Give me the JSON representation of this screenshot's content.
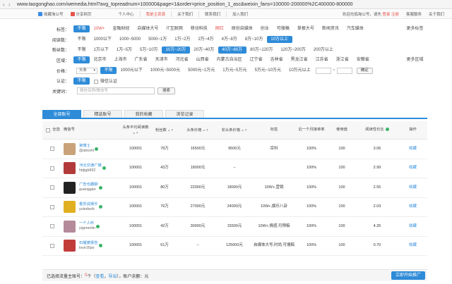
{
  "browser": {
    "url": "www.taogonghao.com/wemedia.html?avg_topreadnum=100000&page=1&order=price_position_1_asc&weixin_fans=100000-200000%2C400000-800000"
  },
  "topbar": {
    "left": [
      "收藏淘公号",
      "分享网页"
    ],
    "nav": [
      {
        "label": "个人中心",
        "hl": false
      },
      {
        "label": "我是主资源",
        "hl": true
      },
      {
        "label": "关于我们",
        "hl": false
      },
      {
        "label": "联系我们",
        "hl": false
      },
      {
        "label": "加入我们",
        "hl": false
      }
    ],
    "welcome": "欢迎光临淘公号，请先",
    "login": "登录",
    "register": "注册",
    "service": "客服服务",
    "about": "关于我们"
  },
  "filters": {
    "tags": {
      "label": "标签：",
      "options": [
        "不限",
        "10W+",
        "金融财经",
        "自媒体大号",
        "IT互联网",
        "移动科技",
        "网红",
        "原创自媒体",
        "创业",
        "可搜稿",
        "草根大号",
        "新闻资讯",
        "汽车媒体"
      ],
      "selected": 0,
      "red": [
        1,
        6
      ],
      "more": "更多标签"
    },
    "reads": {
      "label": "阅读数：",
      "options": [
        "不限",
        "1000以下",
        "1000~5000",
        "5000~1万",
        "1万~2万",
        "2万~4万",
        "4万~8万",
        "8万~10万",
        "10万以上"
      ],
      "selected": 8
    },
    "fans": {
      "label": "粉丝数：",
      "options": [
        "不限",
        "1万以下",
        "1万~5万",
        "5万~10万",
        "10万~20万",
        "20万~40万",
        "40万~80万",
        "80万~120万",
        "120万~200万",
        "200万以上"
      ],
      "selected": [
        4,
        6
      ]
    },
    "region": {
      "label": "区域：",
      "options": [
        "不限",
        "北京市",
        "上海市",
        "广东省",
        "天津市",
        "河北省",
        "山西省",
        "内蒙古自治区",
        "辽宁省",
        "吉林省",
        "黑龙江省",
        "江苏省",
        "浙江省",
        "安徽省"
      ],
      "selected": 0,
      "more": "更多区域"
    },
    "price": {
      "label": "价格：",
      "select": "头条",
      "options": [
        "不限",
        "1000元以下",
        "1000元~5000元",
        "5000元~1万元",
        "1万元~5万元",
        "5万元~10万元",
        "10万元以上"
      ],
      "selected": 0,
      "dash": "~",
      "confirm": "确定"
    },
    "auth": {
      "label": "认证：",
      "options": [
        "不限"
      ],
      "check": "微信认证"
    },
    "keyword": {
      "label": "关键词：",
      "placeholder": "微信名称/微信号",
      "search": "搜索"
    }
  },
  "tabs": [
    "全部账号",
    "精选账号",
    "我的收藏",
    "浏览记录"
  ],
  "table": {
    "headers": [
      "全选",
      "微信号",
      "头条平均阅读数",
      "粉丝数",
      "头条价格",
      "非头条价格",
      "标签",
      "近一个月接单率",
      "使用值",
      "阅读性价比",
      "操作"
    ],
    "rows": [
      {
        "name": "狼博士",
        "id": "@aboshi",
        "reads": "100001",
        "fans": "78万",
        "p1": "16500元",
        "p2": "9500元",
        "tags": "百科",
        "rate": "100%",
        "use": "100",
        "ratio": "3.06",
        "op": "收藏",
        "c": "#c9a27a"
      },
      {
        "name": "河北交通广播",
        "id": "hbjtgb992",
        "reads": "100001",
        "fans": "43万",
        "p1": "18000元",
        "p2": "--",
        "tags": "",
        "rate": "100%",
        "use": "100",
        "ratio": "2.99",
        "op": "收藏",
        "c": "#b33a3a"
      },
      {
        "name": "广告也趣聊",
        "id": "guanggao",
        "reads": "100001",
        "fans": "80万",
        "p1": "22000元",
        "p2": "18000元",
        "tags": "10W+,营销",
        "rate": "100%",
        "use": "100",
        "ratio": "2.55",
        "op": "收藏",
        "c": "#222"
      },
      {
        "name": "看苏说娱乐",
        "id": "yuledsxfz",
        "reads": "100001",
        "fans": "76万",
        "p1": "27000元",
        "p2": "24000元",
        "tags": "10W+,娱乐八卦",
        "rate": "100%",
        "use": "100",
        "ratio": "2.03",
        "op": "收藏",
        "c": "#e0b020"
      },
      {
        "name": "一个人听",
        "id": "yigerentin",
        "reads": "100001",
        "fans": "42万",
        "p1": "30000元",
        "p2": "15500元",
        "tags": "10W+,情感,可预稿",
        "rate": "100%",
        "use": "100",
        "ratio": "4.26",
        "op": "收藏",
        "c": "#b58a9a"
      },
      {
        "name": "石榴婆报告",
        "id": "love16po",
        "reads": "100001",
        "fans": "61万",
        "p1": "--",
        "p2": "125000元",
        "tags": "自媒体大号,时尚,可搜稿",
        "rate": "100%",
        "use": "100",
        "ratio": "0.70",
        "op": "收藏",
        "c": "#c23c3c"
      }
    ]
  },
  "footer": {
    "pre": "已选择流量主账号：",
    "count": "0",
    "mid": "个（",
    "view": "查看",
    "sep": "，",
    "export": "导出",
    "post": "），账户余额：元",
    "button": "立即开始推广"
  }
}
